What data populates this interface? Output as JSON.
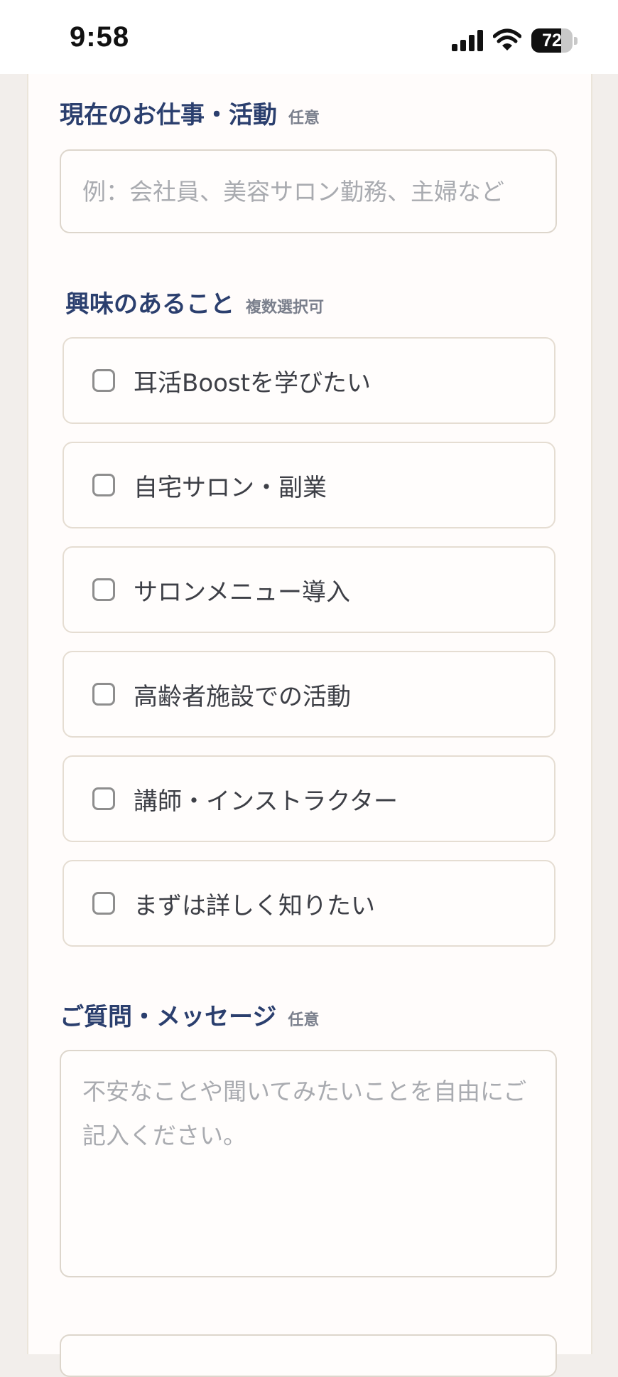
{
  "status_bar": {
    "time": "9:58",
    "battery": "72",
    "battery_level": 0.72
  },
  "occupation": {
    "label": "現在のお仕事・活動",
    "badge": "任意",
    "placeholder": "例：会社員、美容サロン勤務、主婦など"
  },
  "interests": {
    "label": "興味のあること",
    "badge": "複数選択可",
    "options": [
      {
        "label": "耳活Boostを学びたい",
        "checked": false
      },
      {
        "label": "自宅サロン・副業",
        "checked": false
      },
      {
        "label": "サロンメニュー導入",
        "checked": false
      },
      {
        "label": "高齢者施設での活動",
        "checked": false
      },
      {
        "label": "講師・インストラクター",
        "checked": false
      },
      {
        "label": "まずは詳しく知りたい",
        "checked": false
      }
    ]
  },
  "message": {
    "label": "ご質問・メッセージ",
    "badge": "任意",
    "placeholder": "不安なことや聞いてみたいことを自由にご記入ください。"
  }
}
